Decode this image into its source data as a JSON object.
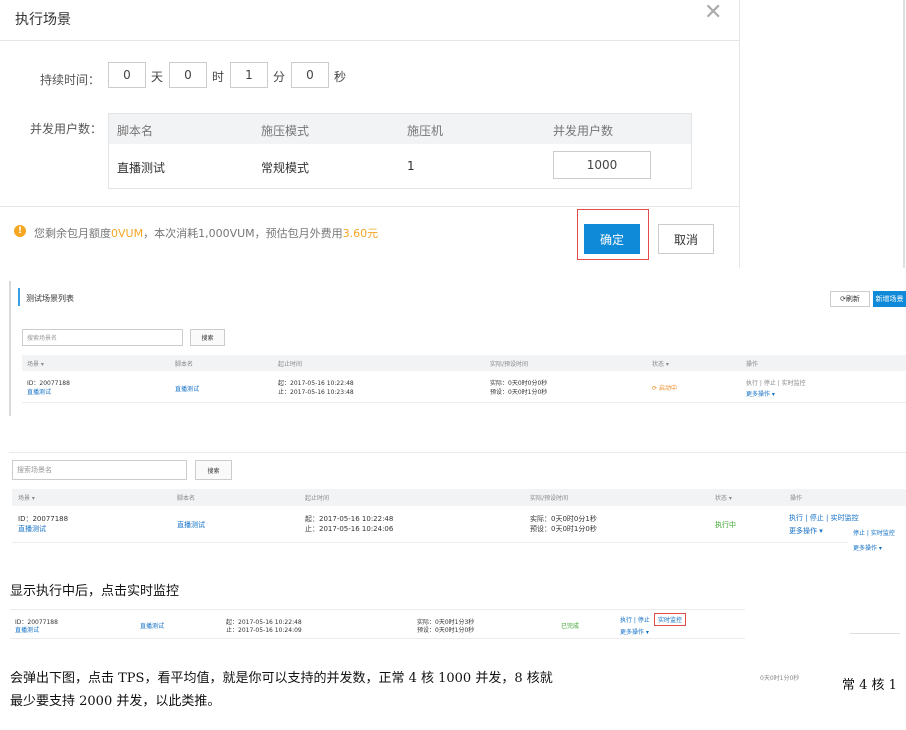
{
  "dialog": {
    "title": "执行场景",
    "close": "✕",
    "duration_label": "持续时间：",
    "duration": [
      {
        "value": "0",
        "unit": "天"
      },
      {
        "value": "0",
        "unit": "时"
      },
      {
        "value": "1",
        "unit": "分"
      },
      {
        "value": "0",
        "unit": "秒"
      }
    ],
    "users_label": "并发用户数：",
    "table_headers": [
      "脚本名",
      "施压模式",
      "施压机",
      "并发用户数"
    ],
    "row": {
      "script": "直播测试",
      "mode": "常规模式",
      "machines": "1",
      "users": "1000"
    },
    "notice_icon": "!",
    "notice_prefix": "您剩余包月额度",
    "notice_quota": "0VUM",
    "notice_middle": "，本次消耗1,000VUM，预估包月外费用",
    "notice_cost": "3.60元",
    "confirm": "确定",
    "cancel": "取消"
  },
  "list1": {
    "title": "测试场景列表",
    "refresh": "⟳刷新",
    "new": "新增场景",
    "search_placeholder": "搜索场景名",
    "search_button": "搜索",
    "headers": [
      "场景 ▾",
      "脚本名",
      "起止时间",
      "实际/预设时间",
      "状态 ▾",
      "操作"
    ],
    "row": {
      "id": "ID：20077188",
      "name": "直播测试",
      "script": "直播测试",
      "start": "起：2017-05-16 10:22:48",
      "end": "止：2017-05-16 10:23:48",
      "actual": "实际：0天0时0分0秒",
      "preset": "预设：0天0时1分0秒",
      "status": "启动中",
      "ops": "执行 | 停止 | 实时监控",
      "more": "更多操作 ▾"
    }
  },
  "list2": {
    "search_placeholder": "搜索场景名",
    "search_button": "搜索",
    "headers": [
      "场景 ▾",
      "脚本名",
      "起止时间",
      "实际/预设时间",
      "状态 ▾",
      "操作"
    ],
    "row": {
      "id": "ID：20077188",
      "name": "直播测试",
      "script": "直播测试",
      "start": "起：2017-05-16 10:22:48",
      "end": "止：2017-05-16 10:24:06",
      "actual": "实际：0天0时0分1秒",
      "preset": "预设：0天0时1分0秒",
      "status": "执行中",
      "ops": "执行 | 停止 | 实时监控",
      "more": "更多操作 ▾",
      "overlay_ops": "停止 | 实时监控",
      "overlay_more": "更多操作 ▾",
      "overlay_status": "状态 ▾"
    }
  },
  "caption1": "显示执行中后，点击实时监控",
  "list3": {
    "row": {
      "id": "ID：20077188",
      "name": "直播测试",
      "script": "直播测试",
      "start": "起：2017-05-16 10:22:48",
      "end": "止：2017-05-16 10:24:09",
      "actual": "实际：0天0时1分3秒",
      "preset": "预设：0天0时1分0秒",
      "status": "已完成",
      "ops": "执行 | 停止",
      "monitor": "实时监控",
      "more": "更多操作 ▾"
    }
  },
  "caption2_line1": "会弹出下图，点击 TPS，看平均值，就是你可以支持的并发数，正常 4 核 1000 并发，8 核就",
  "caption2_tail": "常 4 核 1",
  "caption2_line2": "最少要支持 2000 并发，以此类推。",
  "overlay_small": "0天0时1分0秒"
}
